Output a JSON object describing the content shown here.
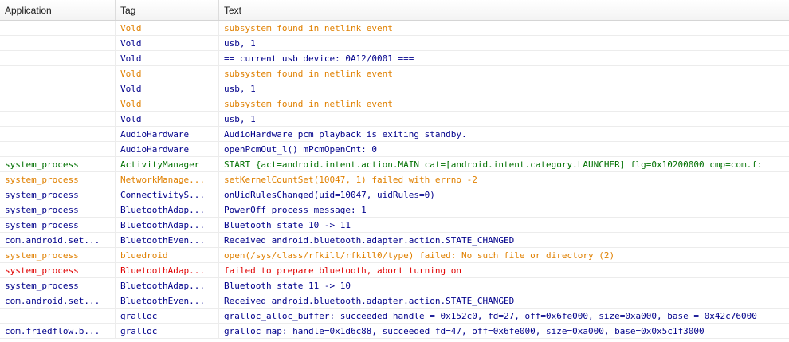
{
  "columns": {
    "application": "Application",
    "tag": "Tag",
    "text": "Text"
  },
  "level_colors": {
    "debug": "#00008b",
    "info": "#007000",
    "warn": "#e08000",
    "error": "#e00000"
  },
  "rows": [
    {
      "application": "",
      "tag": "Vold",
      "text": "subsystem found in netlink event",
      "level": "warn"
    },
    {
      "application": "",
      "tag": "Vold",
      "text": "usb, 1",
      "level": "debug"
    },
    {
      "application": "",
      "tag": "Vold",
      "text": "== current usb device: 0A12/0001 ===",
      "level": "debug"
    },
    {
      "application": "",
      "tag": "Vold",
      "text": "subsystem found in netlink event",
      "level": "warn"
    },
    {
      "application": "",
      "tag": "Vold",
      "text": "usb, 1",
      "level": "debug"
    },
    {
      "application": "",
      "tag": "Vold",
      "text": "subsystem found in netlink event",
      "level": "warn"
    },
    {
      "application": "",
      "tag": "Vold",
      "text": "usb, 1",
      "level": "debug"
    },
    {
      "application": "",
      "tag": "AudioHardware",
      "text": "AudioHardware pcm playback is exiting standby.",
      "level": "debug"
    },
    {
      "application": "",
      "tag": "AudioHardware",
      "text": "openPcmOut_l() mPcmOpenCnt: 0",
      "level": "debug"
    },
    {
      "application": "system_process",
      "tag": "ActivityManager",
      "text": "START {act=android.intent.action.MAIN cat=[android.intent.category.LAUNCHER] flg=0x10200000 cmp=com.f:",
      "level": "info"
    },
    {
      "application": "system_process",
      "tag": "NetworkManage...",
      "text": "setKernelCountSet(10047, 1) failed with errno -2",
      "level": "warn"
    },
    {
      "application": "system_process",
      "tag": "ConnectivityS...",
      "text": "onUidRulesChanged(uid=10047, uidRules=0)",
      "level": "debug"
    },
    {
      "application": "system_process",
      "tag": "BluetoothAdap...",
      "text": "PowerOff process message: 1",
      "level": "debug"
    },
    {
      "application": "system_process",
      "tag": "BluetoothAdap...",
      "text": "Bluetooth state 10 -> 11",
      "level": "debug"
    },
    {
      "application": "com.android.set...",
      "tag": "BluetoothEven...",
      "text": "Received android.bluetooth.adapter.action.STATE_CHANGED",
      "level": "debug"
    },
    {
      "application": "system_process",
      "tag": "bluedroid",
      "text": "open(/sys/class/rfkill/rfkill0/type) failed: No such file or directory (2)",
      "level": "warn"
    },
    {
      "application": "system_process",
      "tag": "BluetoothAdap...",
      "text": "failed to prepare bluetooth, abort turning on",
      "level": "error"
    },
    {
      "application": "system_process",
      "tag": "BluetoothAdap...",
      "text": "Bluetooth state 11 -> 10",
      "level": "debug"
    },
    {
      "application": "com.android.set...",
      "tag": "BluetoothEven...",
      "text": "Received android.bluetooth.adapter.action.STATE_CHANGED",
      "level": "debug"
    },
    {
      "application": "",
      "tag": "gralloc",
      "text": "gralloc_alloc_buffer: succeeded handle = 0x152c0, fd=27, off=0x6fe000, size=0xa000, base = 0x42c76000",
      "level": "debug"
    },
    {
      "application": "com.friedflow.b...",
      "tag": "gralloc",
      "text": "gralloc_map: handle=0x1d6c88, succeeded fd=47, off=0x6fe000, size=0xa000, base=0x0x5c1f3000",
      "level": "debug"
    }
  ]
}
